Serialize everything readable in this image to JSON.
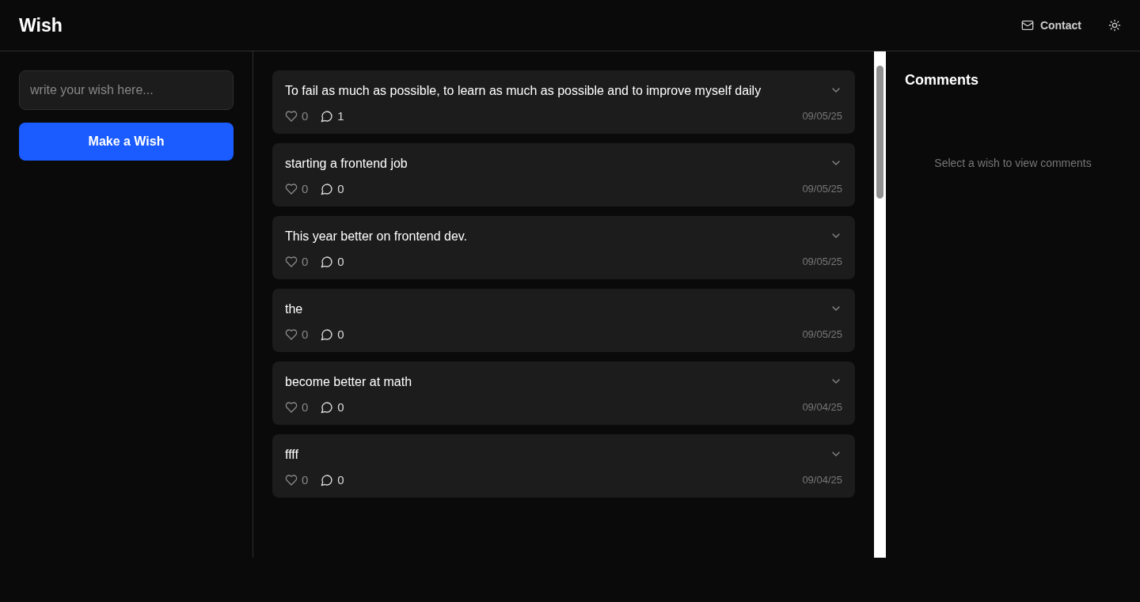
{
  "header": {
    "title": "Wish",
    "contact": "Contact"
  },
  "composer": {
    "placeholder": "write your wish here...",
    "button": "Make a Wish"
  },
  "wishes": [
    {
      "text": "To fail as much as possible, to learn as much as possible and to improve myself daily",
      "likes": "0",
      "comments": "1",
      "date": "09/05/25"
    },
    {
      "text": "starting a frontend job",
      "likes": "0",
      "comments": "0",
      "date": "09/05/25"
    },
    {
      "text": "This year better on frontend dev.",
      "likes": "0",
      "comments": "0",
      "date": "09/05/25"
    },
    {
      "text": "the",
      "likes": "0",
      "comments": "0",
      "date": "09/05/25"
    },
    {
      "text": "become better at math",
      "likes": "0",
      "comments": "0",
      "date": "09/04/25"
    },
    {
      "text": "ffff",
      "likes": "0",
      "comments": "0",
      "date": "09/04/25"
    }
  ],
  "comments_panel": {
    "title": "Comments",
    "empty": "Select a wish to view comments"
  }
}
